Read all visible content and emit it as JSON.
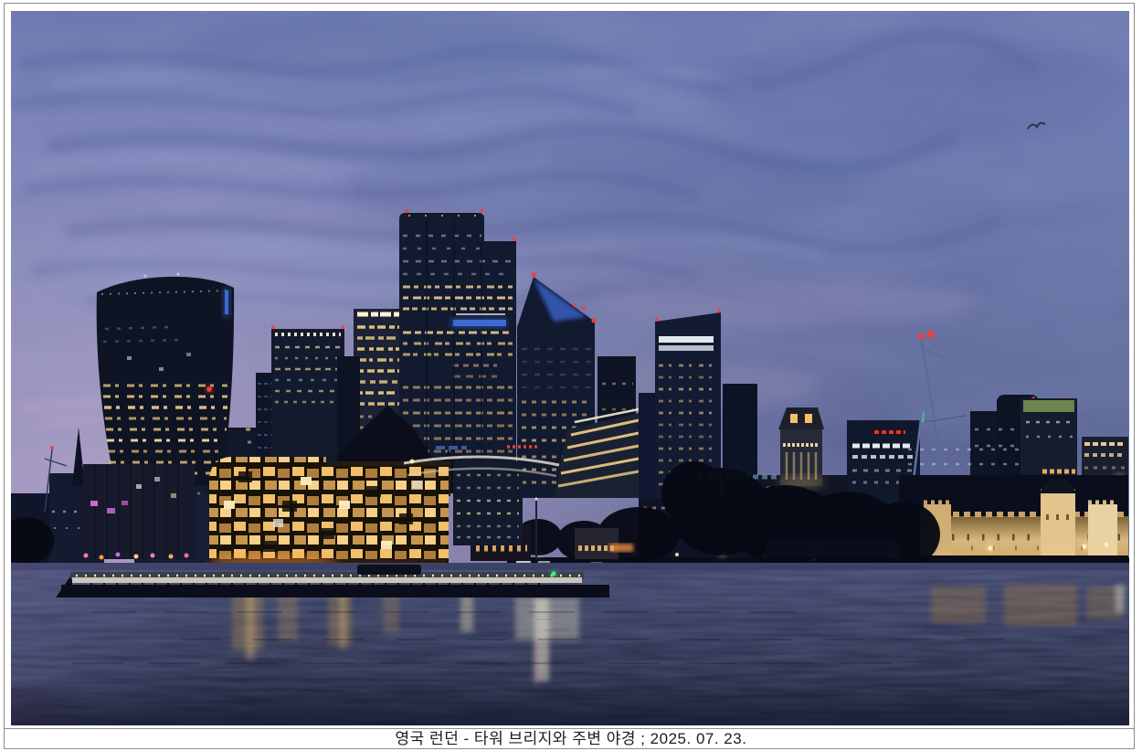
{
  "caption": {
    "text": "영국 런던 - 타워 브리지와 주변 야경 ; 2025. 07. 23."
  },
  "colors": {
    "frame_line": "#8c8c8c",
    "caption_color": "#1c1c1c",
    "page_bg": "#ffffff",
    "aviation_red": "#ff3b30",
    "accent_blue": "#3f6ed8",
    "window_warm": "#ffd98a",
    "sky_top": "#6874ac",
    "sky_glow_left": "#c7a9cc",
    "sky_deep_right": "#2e3f74",
    "water_dark": "#20253e",
    "castle_floodlight": "#d9b87e"
  }
}
